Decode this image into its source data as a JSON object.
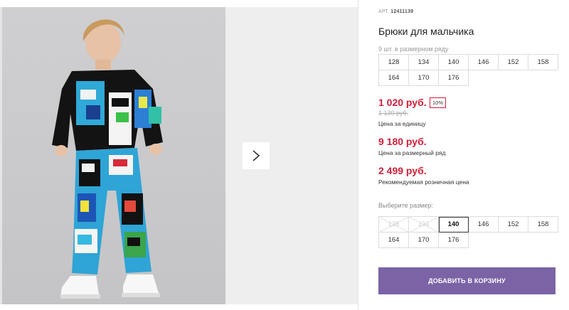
{
  "product": {
    "article_label": "АРТ.",
    "article_value": "12411139",
    "title": "Брюки для мальчика",
    "size_count_text": "9 шт. в размерном ряду",
    "size_range": [
      "128",
      "134",
      "140",
      "146",
      "152",
      "158",
      "164",
      "170",
      "176"
    ]
  },
  "pricing": {
    "price": "1 020 руб.",
    "discount": "10%",
    "old_price": "1 130 руб.",
    "unit_label": "Цена за единицу",
    "row_price": "9 180 руб.",
    "row_label": "Цена за размерный ряд",
    "rrp_price": "2 499 руб.",
    "rrp_label": "Рекомендуемая розничная цена"
  },
  "size_selector": {
    "label": "Выберите размер:",
    "sizes": [
      {
        "value": "128",
        "state": "disabled"
      },
      {
        "value": "134",
        "state": "disabled"
      },
      {
        "value": "140",
        "state": "selected"
      },
      {
        "value": "146",
        "state": "available"
      },
      {
        "value": "152",
        "state": "available"
      },
      {
        "value": "158",
        "state": "available"
      },
      {
        "value": "164",
        "state": "available"
      },
      {
        "value": "170",
        "state": "available"
      },
      {
        "value": "176",
        "state": "available"
      }
    ]
  },
  "gallery": {
    "next_icon": "chevron-right-icon"
  },
  "cart": {
    "add_label": "ДОБАВИТЬ В КОРЗИНУ"
  },
  "colors": {
    "price_red": "#d0203a",
    "button_purple": "#7b63a6"
  }
}
